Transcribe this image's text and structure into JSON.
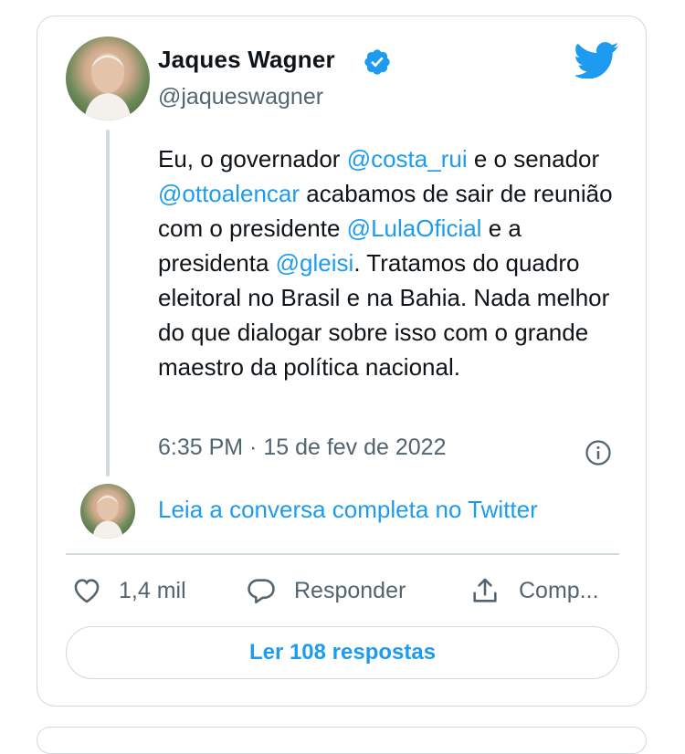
{
  "author": {
    "name": "Jaques Wagner",
    "handle": "@jaqueswagner"
  },
  "tweet": {
    "p1": "Eu, o governador ",
    "m1": "@costa_rui",
    "p2": " e o senador ",
    "m2": "@ottoalencar",
    "p3": " acabamos de sair de reunião com o presidente ",
    "m3": "@LulaOficial",
    "p4": " e a presidenta ",
    "m4": "@gleisi",
    "p5": ". Tratamos do quadro eleitoral no Brasil e na Bahia. Nada melhor do que dialogar sobre isso com o grande maestro da política nacional."
  },
  "timestamp": "6:35 PM · 15 de fev de 2022",
  "read_conversation": "Leia a conversa completa no Twitter",
  "actions": {
    "likes": "1,4 mil",
    "reply": "Responder",
    "share": "Comp..."
  },
  "read_replies": "Ler 108 respostas",
  "colors": {
    "accent": "#1d9bf0",
    "text": "#0f1419",
    "secondary": "#536471",
    "border": "#cfd9de"
  },
  "icons": [
    "verified-badge-icon",
    "twitter-bird-icon",
    "info-icon",
    "heart-icon",
    "reply-bubble-icon",
    "share-icon"
  ]
}
